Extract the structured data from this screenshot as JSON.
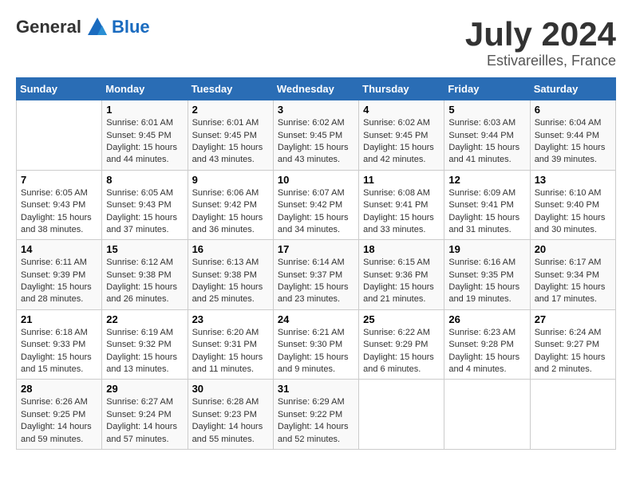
{
  "header": {
    "logo_general": "General",
    "logo_blue": "Blue",
    "month": "July 2024",
    "location": "Estivareilles, France"
  },
  "calendar": {
    "days_of_week": [
      "Sunday",
      "Monday",
      "Tuesday",
      "Wednesday",
      "Thursday",
      "Friday",
      "Saturday"
    ],
    "weeks": [
      [
        {
          "day": "",
          "info": ""
        },
        {
          "day": "1",
          "info": "Sunrise: 6:01 AM\nSunset: 9:45 PM\nDaylight: 15 hours\nand 44 minutes."
        },
        {
          "day": "2",
          "info": "Sunrise: 6:01 AM\nSunset: 9:45 PM\nDaylight: 15 hours\nand 43 minutes."
        },
        {
          "day": "3",
          "info": "Sunrise: 6:02 AM\nSunset: 9:45 PM\nDaylight: 15 hours\nand 43 minutes."
        },
        {
          "day": "4",
          "info": "Sunrise: 6:02 AM\nSunset: 9:45 PM\nDaylight: 15 hours\nand 42 minutes."
        },
        {
          "day": "5",
          "info": "Sunrise: 6:03 AM\nSunset: 9:44 PM\nDaylight: 15 hours\nand 41 minutes."
        },
        {
          "day": "6",
          "info": "Sunrise: 6:04 AM\nSunset: 9:44 PM\nDaylight: 15 hours\nand 39 minutes."
        }
      ],
      [
        {
          "day": "7",
          "info": "Sunrise: 6:05 AM\nSunset: 9:43 PM\nDaylight: 15 hours\nand 38 minutes."
        },
        {
          "day": "8",
          "info": "Sunrise: 6:05 AM\nSunset: 9:43 PM\nDaylight: 15 hours\nand 37 minutes."
        },
        {
          "day": "9",
          "info": "Sunrise: 6:06 AM\nSunset: 9:42 PM\nDaylight: 15 hours\nand 36 minutes."
        },
        {
          "day": "10",
          "info": "Sunrise: 6:07 AM\nSunset: 9:42 PM\nDaylight: 15 hours\nand 34 minutes."
        },
        {
          "day": "11",
          "info": "Sunrise: 6:08 AM\nSunset: 9:41 PM\nDaylight: 15 hours\nand 33 minutes."
        },
        {
          "day": "12",
          "info": "Sunrise: 6:09 AM\nSunset: 9:41 PM\nDaylight: 15 hours\nand 31 minutes."
        },
        {
          "day": "13",
          "info": "Sunrise: 6:10 AM\nSunset: 9:40 PM\nDaylight: 15 hours\nand 30 minutes."
        }
      ],
      [
        {
          "day": "14",
          "info": "Sunrise: 6:11 AM\nSunset: 9:39 PM\nDaylight: 15 hours\nand 28 minutes."
        },
        {
          "day": "15",
          "info": "Sunrise: 6:12 AM\nSunset: 9:38 PM\nDaylight: 15 hours\nand 26 minutes."
        },
        {
          "day": "16",
          "info": "Sunrise: 6:13 AM\nSunset: 9:38 PM\nDaylight: 15 hours\nand 25 minutes."
        },
        {
          "day": "17",
          "info": "Sunrise: 6:14 AM\nSunset: 9:37 PM\nDaylight: 15 hours\nand 23 minutes."
        },
        {
          "day": "18",
          "info": "Sunrise: 6:15 AM\nSunset: 9:36 PM\nDaylight: 15 hours\nand 21 minutes."
        },
        {
          "day": "19",
          "info": "Sunrise: 6:16 AM\nSunset: 9:35 PM\nDaylight: 15 hours\nand 19 minutes."
        },
        {
          "day": "20",
          "info": "Sunrise: 6:17 AM\nSunset: 9:34 PM\nDaylight: 15 hours\nand 17 minutes."
        }
      ],
      [
        {
          "day": "21",
          "info": "Sunrise: 6:18 AM\nSunset: 9:33 PM\nDaylight: 15 hours\nand 15 minutes."
        },
        {
          "day": "22",
          "info": "Sunrise: 6:19 AM\nSunset: 9:32 PM\nDaylight: 15 hours\nand 13 minutes."
        },
        {
          "day": "23",
          "info": "Sunrise: 6:20 AM\nSunset: 9:31 PM\nDaylight: 15 hours\nand 11 minutes."
        },
        {
          "day": "24",
          "info": "Sunrise: 6:21 AM\nSunset: 9:30 PM\nDaylight: 15 hours\nand 9 minutes."
        },
        {
          "day": "25",
          "info": "Sunrise: 6:22 AM\nSunset: 9:29 PM\nDaylight: 15 hours\nand 6 minutes."
        },
        {
          "day": "26",
          "info": "Sunrise: 6:23 AM\nSunset: 9:28 PM\nDaylight: 15 hours\nand 4 minutes."
        },
        {
          "day": "27",
          "info": "Sunrise: 6:24 AM\nSunset: 9:27 PM\nDaylight: 15 hours\nand 2 minutes."
        }
      ],
      [
        {
          "day": "28",
          "info": "Sunrise: 6:26 AM\nSunset: 9:25 PM\nDaylight: 14 hours\nand 59 minutes."
        },
        {
          "day": "29",
          "info": "Sunrise: 6:27 AM\nSunset: 9:24 PM\nDaylight: 14 hours\nand 57 minutes."
        },
        {
          "day": "30",
          "info": "Sunrise: 6:28 AM\nSunset: 9:23 PM\nDaylight: 14 hours\nand 55 minutes."
        },
        {
          "day": "31",
          "info": "Sunrise: 6:29 AM\nSunset: 9:22 PM\nDaylight: 14 hours\nand 52 minutes."
        },
        {
          "day": "",
          "info": ""
        },
        {
          "day": "",
          "info": ""
        },
        {
          "day": "",
          "info": ""
        }
      ]
    ]
  }
}
